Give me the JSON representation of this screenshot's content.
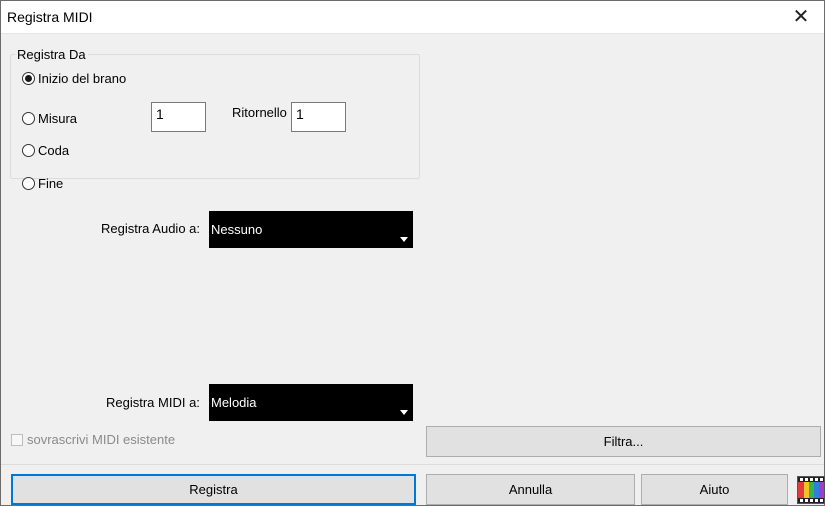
{
  "window": {
    "title": "Registra MIDI",
    "close_label": "✕"
  },
  "record_from": {
    "group_title": "Registra Da",
    "options": [
      {
        "label": "Inizio del brano",
        "checked": true
      },
      {
        "label": "Misura",
        "checked": false
      },
      {
        "label": "Coda",
        "checked": false
      },
      {
        "label": "Fine",
        "checked": false
      }
    ],
    "bar_value": "1",
    "repeat_label": "Ritornello",
    "repeat_value": "1"
  },
  "audio": {
    "label": "Registra Audio a:",
    "value": "Nessuno"
  },
  "midi": {
    "label": "Registra MIDI a:",
    "value": "Melodia"
  },
  "overwrite": {
    "label": "sovrascrivi MIDI esistente",
    "checked": false
  },
  "buttons": {
    "filter": "Filtra...",
    "record": "Registra",
    "cancel": "Annulla",
    "help": "Aiuto"
  },
  "icons": {
    "close": "close-icon",
    "palette": "color-palette-icon"
  }
}
